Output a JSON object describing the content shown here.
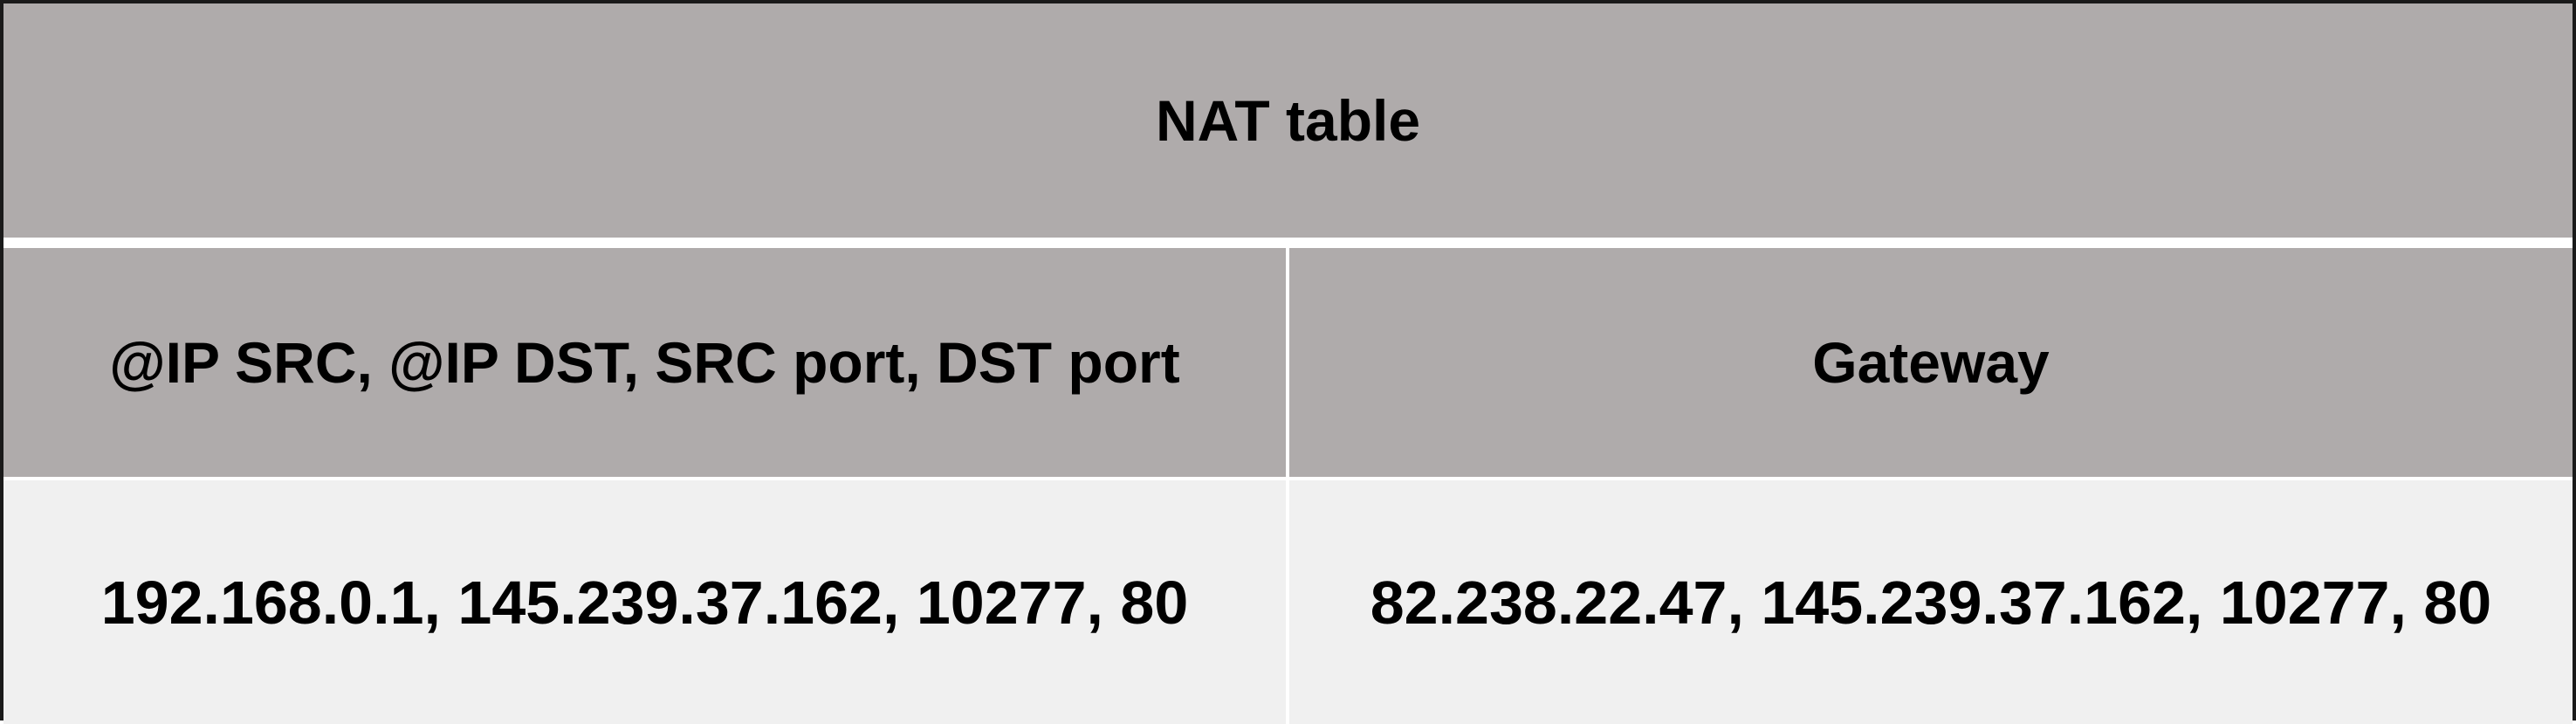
{
  "table": {
    "title": "NAT table",
    "columns": [
      {
        "header": "@IP SRC, @IP DST, SRC port, DST port"
      },
      {
        "header": "Gateway"
      }
    ],
    "rows": [
      [
        "192.168.0.1, 145.239.37.162, 10277, 80",
        "82.238.22.47, 145.239.37.162, 10277, 80"
      ]
    ]
  },
  "colors": {
    "header_background": "#afabab",
    "row_background": "#f0f0f0",
    "border": "#1a1a1a",
    "separator": "#ffffff"
  }
}
